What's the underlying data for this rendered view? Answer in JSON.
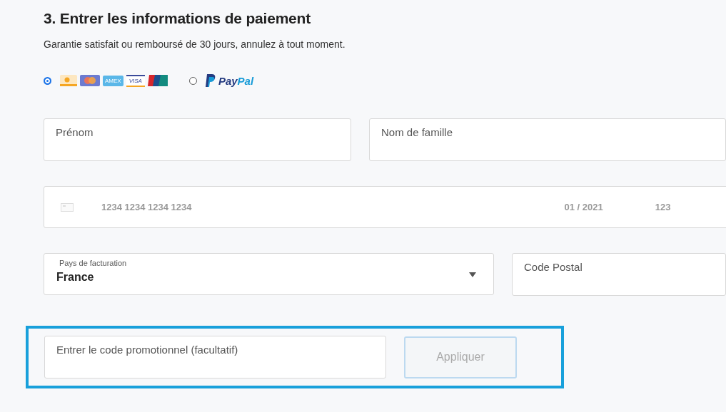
{
  "heading": "3. Entrer les informations de paiement",
  "subtitle": "Garantie satisfait ou remboursé de 30 jours, annulez à tout moment.",
  "payment_methods": [
    {
      "kind": "cards",
      "selected": true,
      "labels": [
        "AMEX",
        "VISA"
      ]
    },
    {
      "kind": "paypal",
      "selected": false,
      "label": "PayPal"
    }
  ],
  "name_fields": [
    {
      "placeholder": "Prénom"
    },
    {
      "placeholder": "Nom de famille"
    }
  ],
  "card_field": {
    "number_placeholder": "1234 1234 1234 1234",
    "expiry_placeholder": "01 / 2021",
    "cvc_placeholder": "123"
  },
  "country_select": {
    "label": "Pays de facturation",
    "value": "France"
  },
  "postal_field": {
    "placeholder": "Code Postal"
  },
  "promo": {
    "placeholder": "Entrer le code promotionnel (facultatif)",
    "button": "Appliquer",
    "disabled": true,
    "highlighted": true
  }
}
